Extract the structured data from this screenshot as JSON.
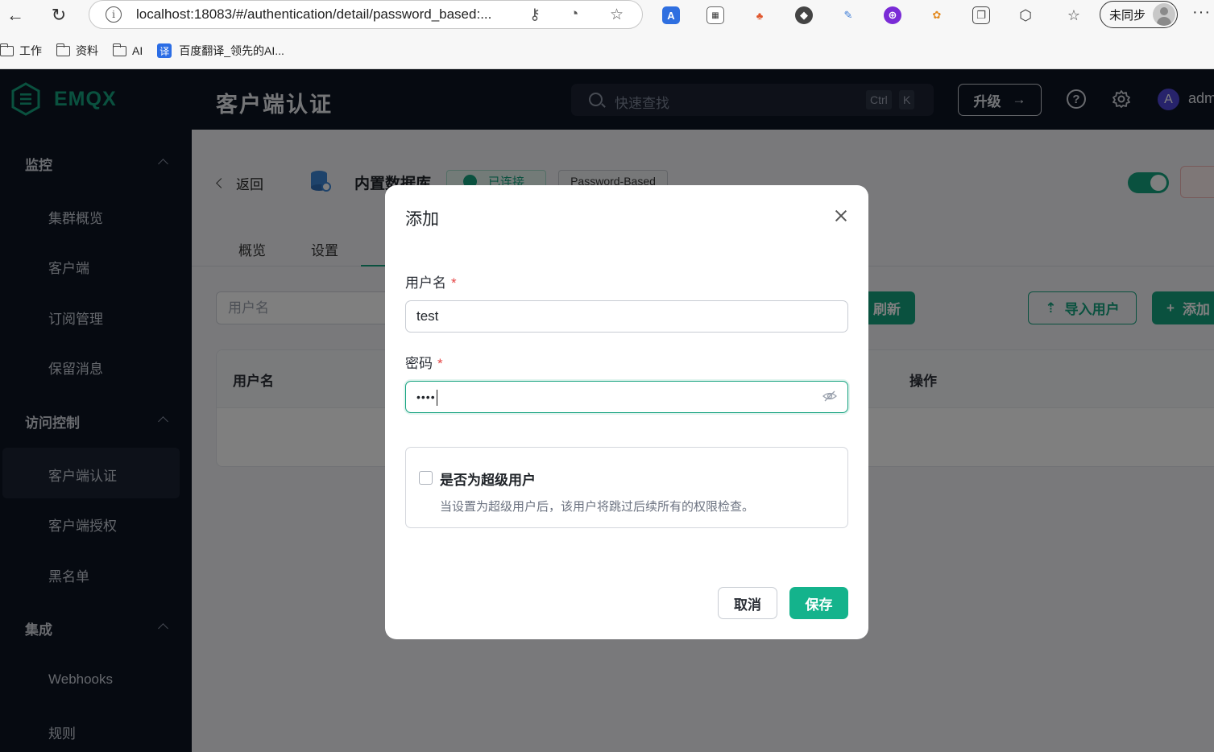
{
  "browser": {
    "url": "localhost:18083/#/authentication/detail/password_based:...",
    "sync_label": "未同步",
    "more_label": "···",
    "bookmarks": [
      "工作",
      "资料",
      "AI",
      "百度翻译_领先的AI..."
    ],
    "translate_glyph": "译"
  },
  "header": {
    "brand": "EMQX",
    "title": "客户端认证",
    "search_placeholder": "快速查找",
    "kbd_ctrl": "Ctrl",
    "kbd_k": "K",
    "upgrade_label": "升级",
    "upgrade_arrow": "→",
    "help_glyph": "?",
    "avatar_letter": "A",
    "user_name": "adm"
  },
  "sidebar": {
    "groups": [
      {
        "label": "监控",
        "items": [
          "集群概览",
          "客户端",
          "订阅管理",
          "保留消息"
        ]
      },
      {
        "label": "访问控制",
        "items": [
          "客户端认证",
          "客户端授权",
          "黑名单"
        ]
      },
      {
        "label": "集成",
        "items": [
          "Webhooks",
          "规则"
        ]
      }
    ],
    "active_item": "客户端认证"
  },
  "detail": {
    "back_label": "返回",
    "db_title": "内置数据库",
    "status_tag": "已连接",
    "type_tag": "Password-Based",
    "enabled": true,
    "tabs": [
      "概览",
      "设置"
    ],
    "filter_placeholder": "用户名",
    "refresh_label": "刷新",
    "import_label": "导入用户",
    "add_label": "添加",
    "table_headers": [
      "用户名",
      "操作"
    ]
  },
  "dialog": {
    "title": "添加",
    "username_label": "用户名",
    "username_value": "test",
    "password_label": "密码",
    "password_value": "••••",
    "required_mark": "*",
    "superuser_label": "是否为超级用户",
    "superuser_desc": "当设置为超级用户后，该用户将跳过后续所有的权限检查。",
    "superuser_checked": false,
    "cancel_label": "取消",
    "save_label": "保存"
  },
  "colors": {
    "accent": "#14a27f",
    "dark_bg": "#0d1423"
  }
}
